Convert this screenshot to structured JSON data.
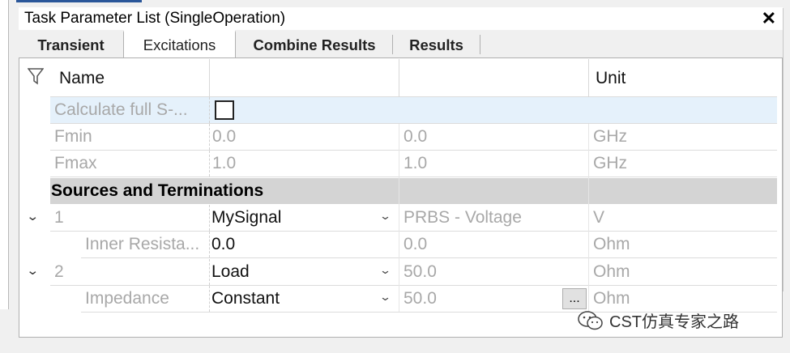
{
  "window": {
    "title": "Task Parameter List (SingleOperation)",
    "close_glyph": "✕"
  },
  "tabs": [
    {
      "label": "Transient",
      "active": false
    },
    {
      "label": "Excitations",
      "active": true
    },
    {
      "label": "Combine Results",
      "active": false
    },
    {
      "label": "Results",
      "active": false
    }
  ],
  "grid": {
    "columns": {
      "name": "Name",
      "col2": "",
      "col3": "",
      "unit": "Unit"
    },
    "rows": [
      {
        "name": "Calculate full S-...",
        "checked": false
      },
      {
        "name": "Fmin",
        "value": "0.0",
        "col3": "0.0",
        "unit": "GHz"
      },
      {
        "name": "Fmax",
        "value": "1.0",
        "col3": "1.0",
        "unit": "GHz"
      }
    ],
    "section": "Sources and Terminations",
    "sources": [
      {
        "index": "1",
        "value": "MySignal",
        "col3": "PRBS - Voltage",
        "unit": "V"
      },
      {
        "name": "Inner Resista...",
        "value": "0.0",
        "col3": "0.0",
        "unit": "Ohm"
      },
      {
        "index": "2",
        "value": "Load",
        "col3": "50.0",
        "unit": "Ohm"
      },
      {
        "name": "Impedance",
        "value": "Constant",
        "col3": "50.0",
        "button": "...",
        "unit": "Ohm"
      }
    ]
  },
  "watermark": "CST仿真专家之路",
  "colors": {
    "accent": "#2b579a",
    "selected_row": "#e5f1fb",
    "section_bg": "#d4d4d4",
    "muted_text": "#a8a8a8"
  }
}
